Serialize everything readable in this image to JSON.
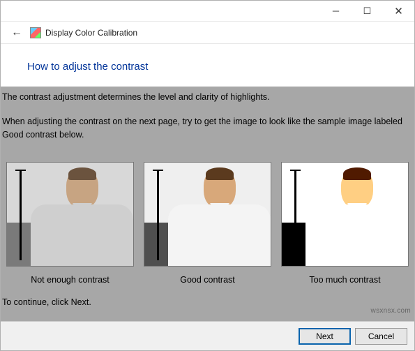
{
  "window": {
    "app_title": "Display Color Calibration"
  },
  "page": {
    "title": "How to adjust the contrast",
    "paragraph1": "The contrast adjustment determines the level and clarity of highlights.",
    "paragraph2": "When adjusting the contrast on the next page, try to get the image to look like the sample image labeled Good contrast below.",
    "continue_hint": "To continue, click Next."
  },
  "samples": [
    {
      "label": "Not enough contrast"
    },
    {
      "label": "Good contrast"
    },
    {
      "label": "Too much contrast"
    }
  ],
  "footer": {
    "next_label": "Next",
    "cancel_label": "Cancel"
  },
  "watermark": "wsxnsx.com"
}
